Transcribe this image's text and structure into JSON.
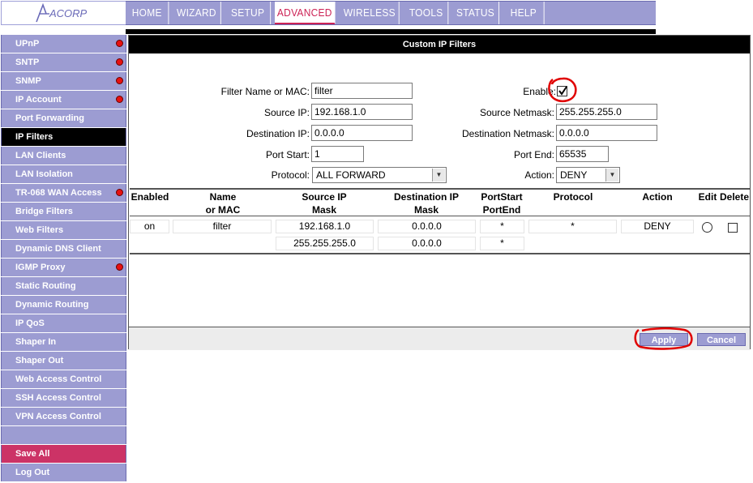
{
  "logo_text": "ACORP",
  "nav": [
    "HOME",
    "WIZARD",
    "SETUP",
    "ADVANCED",
    "WIRELESS",
    "TOOLS",
    "STATUS",
    "HELP"
  ],
  "nav_active": "ADVANCED",
  "sidebar": [
    {
      "label": "UPnP",
      "dot": true
    },
    {
      "label": "SNTP",
      "dot": true
    },
    {
      "label": "SNMP",
      "dot": true
    },
    {
      "label": "IP Account",
      "dot": true
    },
    {
      "label": "Port Forwarding",
      "dot": false
    },
    {
      "label": "IP Filters",
      "dot": false,
      "active": true
    },
    {
      "label": "LAN Clients",
      "dot": false
    },
    {
      "label": "LAN Isolation",
      "dot": false
    },
    {
      "label": "TR-068 WAN Access",
      "dot": true
    },
    {
      "label": "Bridge Filters",
      "dot": false
    },
    {
      "label": "Web Filters",
      "dot": false
    },
    {
      "label": "Dynamic DNS Client",
      "dot": false
    },
    {
      "label": "IGMP Proxy",
      "dot": true
    },
    {
      "label": "Static Routing",
      "dot": false
    },
    {
      "label": "Dynamic Routing",
      "dot": false
    },
    {
      "label": "IP QoS",
      "dot": false
    },
    {
      "label": "Shaper In",
      "dot": false
    },
    {
      "label": "Shaper Out",
      "dot": false
    },
    {
      "label": "Web Access Control",
      "dot": false
    },
    {
      "label": "SSH Access Control",
      "dot": false
    },
    {
      "label": "VPN Access Control",
      "dot": false
    },
    {
      "label": "",
      "dot": false,
      "spacer": true
    },
    {
      "label": "Save All",
      "dot": false,
      "save": true
    },
    {
      "label": "Log Out",
      "dot": false
    }
  ],
  "panel_title": "Custom IP Filters",
  "form": {
    "filter_name_label": "Filter Name or MAC:",
    "filter_name_value": "filter",
    "enable_label": "Enable:",
    "enable_checked": true,
    "source_ip_label": "Source IP:",
    "source_ip_value": "192.168.1.0",
    "source_netmask_label": "Source Netmask:",
    "source_netmask_value": "255.255.255.0",
    "dest_ip_label": "Destination IP:",
    "dest_ip_value": "0.0.0.0",
    "dest_netmask_label": "Destination Netmask:",
    "dest_netmask_value": "0.0.0.0",
    "port_start_label": "Port Start:",
    "port_start_value": "1",
    "port_end_label": "Port End:",
    "port_end_value": "65535",
    "protocol_label": "Protocol:",
    "protocol_value": "ALL FORWARD",
    "action_label": "Action:",
    "action_value": "DENY"
  },
  "table": {
    "headers": {
      "enabled": "Enabled",
      "name_1": "Name",
      "name_2": "or MAC",
      "src_1": "Source IP",
      "src_2": "Mask",
      "dst_1": "Destination IP",
      "dst_2": "Mask",
      "port_1": "PortStart",
      "port_2": "PortEnd",
      "protocol": "Protocol",
      "action": "Action",
      "edit": "Edit",
      "delete": "Delete"
    },
    "row": {
      "enabled": "on",
      "name": "filter",
      "source_ip": "192.168.1.0",
      "source_mask": "255.255.255.0",
      "dest_ip": "0.0.0.0",
      "dest_mask": "0.0.0.0",
      "port_start": "*",
      "port_end": "*",
      "protocol": "*",
      "action": "DENY"
    }
  },
  "buttons": {
    "apply": "Apply",
    "cancel": "Cancel"
  },
  "colors": {
    "nav": "#9c9cd2",
    "active": "#cc2255",
    "annotation": "#e00000"
  }
}
